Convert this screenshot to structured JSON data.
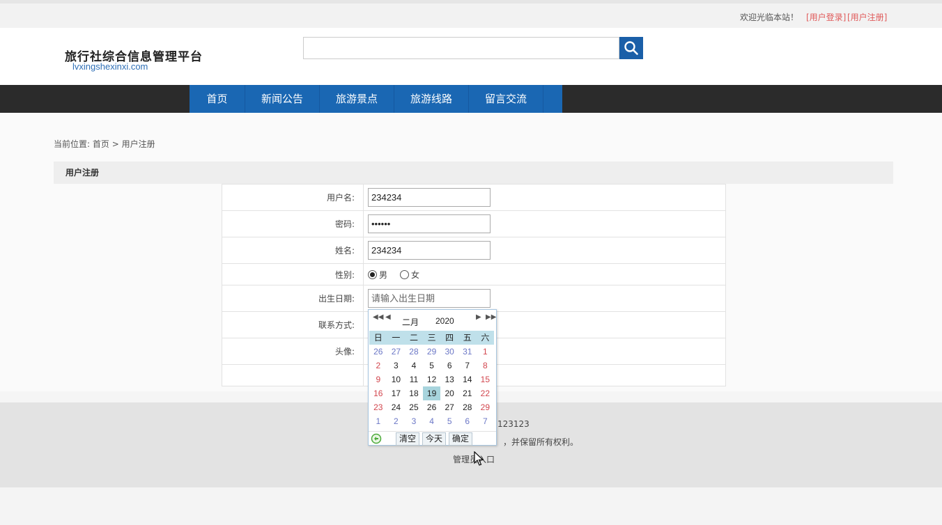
{
  "topbar": {
    "welcome": "欢迎光临本站！",
    "login": "[用户登录]",
    "register": "[用户注册]"
  },
  "header": {
    "logo_cn": "旅行社综合信息管理平台",
    "logo_en": "lvxingshexinxi.com",
    "search_placeholder": ""
  },
  "nav": {
    "items": [
      "首页",
      "新闻公告",
      "旅游景点",
      "旅游线路",
      "留言交流"
    ]
  },
  "breadcrumb": {
    "prefix": "当前位置:",
    "home": "首页",
    "sep": " > ",
    "current": "用户注册"
  },
  "section": {
    "title": "用户注册"
  },
  "form": {
    "username_label": "用户名:",
    "username_value": "234234",
    "password_label": "密码:",
    "password_value": "234234",
    "name_label": "姓名:",
    "name_value": "234234",
    "gender_label": "性别:",
    "gender_male": "男",
    "gender_female": "女",
    "gender_selected": "男",
    "birth_label": "出生日期:",
    "birth_placeholder": "请输入出生日期",
    "contact_label": "联系方式:",
    "avatar_label": "头像:"
  },
  "calendar": {
    "month": "二月",
    "year": "2020",
    "weekdays": [
      "日",
      "一",
      "二",
      "三",
      "四",
      "五",
      "六"
    ],
    "days": [
      [
        "26",
        "27",
        "28",
        "29",
        "30",
        "31",
        "1"
      ],
      [
        "2",
        "3",
        "4",
        "5",
        "6",
        "7",
        "8"
      ],
      [
        "9",
        "10",
        "11",
        "12",
        "13",
        "14",
        "15"
      ],
      [
        "16",
        "17",
        "18",
        "19",
        "20",
        "21",
        "22"
      ],
      [
        "23",
        "24",
        "25",
        "26",
        "27",
        "28",
        "29"
      ],
      [
        "1",
        "2",
        "3",
        "4",
        "5",
        "6",
        "7"
      ]
    ],
    "selected": "19",
    "clear": "清空",
    "today": "今天",
    "ok": "确定"
  },
  "footer": {
    "line1": "123123",
    "line2": "，并保留所有权利。",
    "admin": "管理员入口"
  },
  "colors": {
    "nav_active": "#1a67b3",
    "nav_bar": "#2b2b2b",
    "accent_link": "#e05a5a",
    "search_btn": "#1a5fa8"
  }
}
